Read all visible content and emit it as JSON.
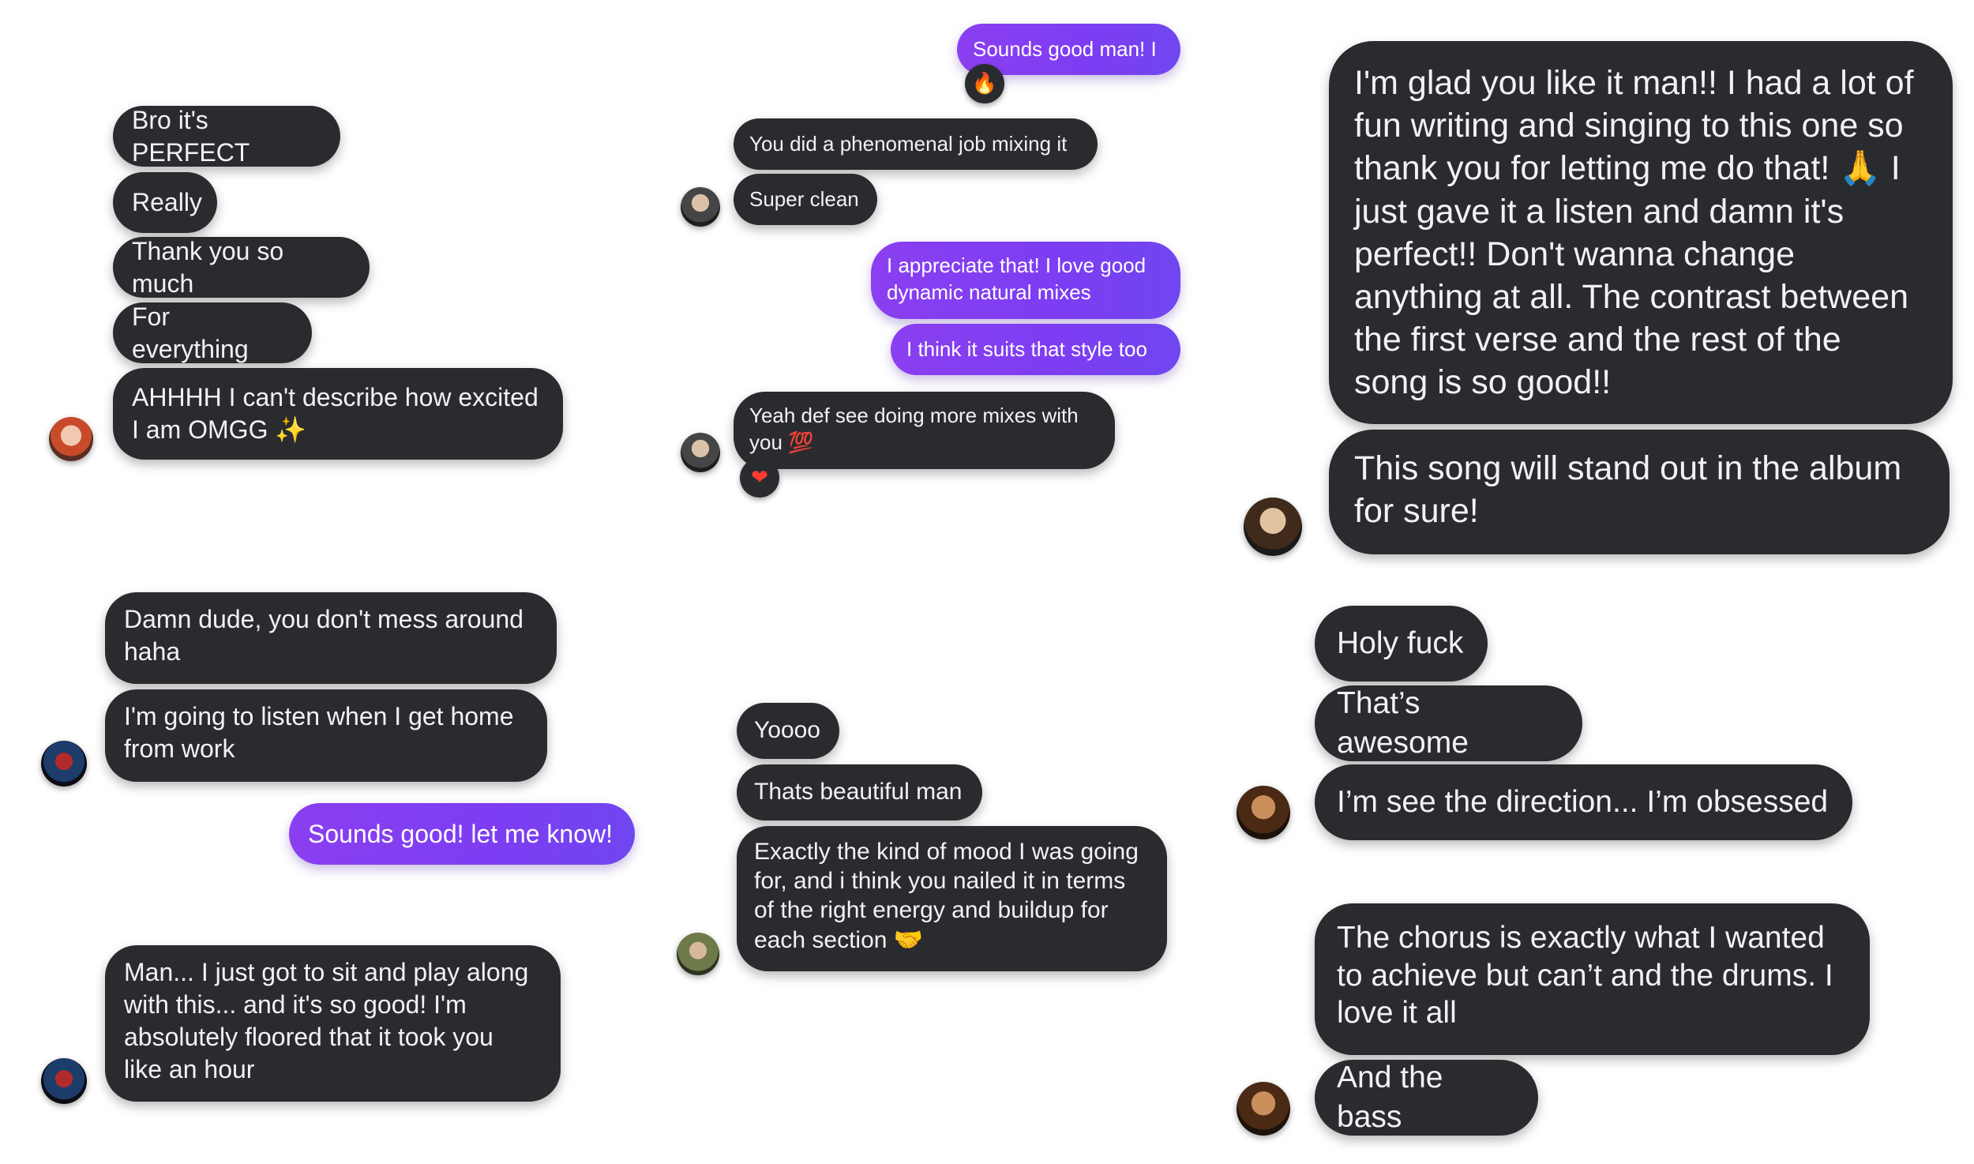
{
  "colors": {
    "incoming_bubble": "#2a2b2f",
    "outgoing_bubble": "#7d3df2",
    "background": "#ffffff"
  },
  "threads": {
    "t1": {
      "messages": [
        "Bro it's PERFECT",
        "Really",
        "Thank you so much",
        "For everything",
        "AHHHH I can't describe how excited\nI am OMGG ✨"
      ]
    },
    "t2": {
      "messages": [
        "Damn dude, you don't mess around\nhaha",
        "I'm going to listen when I get home\nfrom work",
        "Sounds good! let me know!"
      ]
    },
    "t3": {
      "messages": [
        "Man... I just got to sit and play along\nwith this... and it's so good! I'm\nabsolutely floored that it took you\nlike an hour"
      ]
    },
    "t4": {
      "messages": [
        "Sounds good man! I",
        "You did a phenomenal job mixing it",
        "Super clean",
        "I appreciate that! I love good\ndynamic natural mixes",
        "I think it suits that style too",
        "Yeah def see doing more mixes with\nyou 💯"
      ],
      "reactions": [
        "fire-emoji",
        "heart-emoji"
      ],
      "reaction_glyphs": [
        "🔥",
        "❤"
      ]
    },
    "t5": {
      "messages": [
        "Yoooo",
        "Thats beautiful man",
        "Exactly the kind of mood I was going\nfor, and i think you nailed it in terms\nof the right energy and buildup for\neach section 🤝"
      ]
    },
    "t6": {
      "messages": [
        "I'm glad you like it man!! I had a lot of\nfun writing and singing to this one so\nthank you for letting me do that! 🙏 I\njust gave it a listen and damn it's\nperfect!! Don't wanna change\nanything at all. The contrast between\nthe first verse and the rest of the\nsong is so good!!",
        "This song will stand out in the album\nfor sure!"
      ]
    },
    "t7": {
      "messages": [
        "Holy fuck",
        "That’s awesome",
        "I’m see the direction... I’m obsessed",
        "The chorus is exactly what I wanted\nto achieve but can’t and the drums. I\nlove it all",
        "And the bass"
      ]
    }
  }
}
